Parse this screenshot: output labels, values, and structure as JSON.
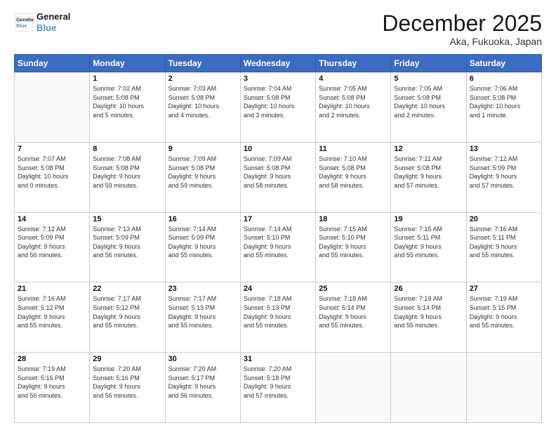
{
  "header": {
    "logo_line1": "General",
    "logo_line2": "Blue",
    "month": "December 2025",
    "location": "Aka, Fukuoka, Japan"
  },
  "weekdays": [
    "Sunday",
    "Monday",
    "Tuesday",
    "Wednesday",
    "Thursday",
    "Friday",
    "Saturday"
  ],
  "weeks": [
    [
      {
        "day": "",
        "info": ""
      },
      {
        "day": "1",
        "info": "Sunrise: 7:02 AM\nSunset: 5:08 PM\nDaylight: 10 hours\nand 5 minutes."
      },
      {
        "day": "2",
        "info": "Sunrise: 7:03 AM\nSunset: 5:08 PM\nDaylight: 10 hours\nand 4 minutes."
      },
      {
        "day": "3",
        "info": "Sunrise: 7:04 AM\nSunset: 5:08 PM\nDaylight: 10 hours\nand 3 minutes."
      },
      {
        "day": "4",
        "info": "Sunrise: 7:05 AM\nSunset: 5:08 PM\nDaylight: 10 hours\nand 2 minutes."
      },
      {
        "day": "5",
        "info": "Sunrise: 7:05 AM\nSunset: 5:08 PM\nDaylight: 10 hours\nand 2 minutes."
      },
      {
        "day": "6",
        "info": "Sunrise: 7:06 AM\nSunset: 5:08 PM\nDaylight: 10 hours\nand 1 minute."
      }
    ],
    [
      {
        "day": "7",
        "info": "Sunrise: 7:07 AM\nSunset: 5:08 PM\nDaylight: 10 hours\nand 0 minutes."
      },
      {
        "day": "8",
        "info": "Sunrise: 7:08 AM\nSunset: 5:08 PM\nDaylight: 9 hours\nand 59 minutes."
      },
      {
        "day": "9",
        "info": "Sunrise: 7:09 AM\nSunset: 5:08 PM\nDaylight: 9 hours\nand 59 minutes."
      },
      {
        "day": "10",
        "info": "Sunrise: 7:09 AM\nSunset: 5:08 PM\nDaylight: 9 hours\nand 58 minutes."
      },
      {
        "day": "11",
        "info": "Sunrise: 7:10 AM\nSunset: 5:08 PM\nDaylight: 9 hours\nand 58 minutes."
      },
      {
        "day": "12",
        "info": "Sunrise: 7:11 AM\nSunset: 5:08 PM\nDaylight: 9 hours\nand 57 minutes."
      },
      {
        "day": "13",
        "info": "Sunrise: 7:12 AM\nSunset: 5:09 PM\nDaylight: 9 hours\nand 57 minutes."
      }
    ],
    [
      {
        "day": "14",
        "info": "Sunrise: 7:12 AM\nSunset: 5:09 PM\nDaylight: 9 hours\nand 56 minutes."
      },
      {
        "day": "15",
        "info": "Sunrise: 7:13 AM\nSunset: 5:09 PM\nDaylight: 9 hours\nand 56 minutes."
      },
      {
        "day": "16",
        "info": "Sunrise: 7:14 AM\nSunset: 5:09 PM\nDaylight: 9 hours\nand 55 minutes."
      },
      {
        "day": "17",
        "info": "Sunrise: 7:14 AM\nSunset: 5:10 PM\nDaylight: 9 hours\nand 55 minutes."
      },
      {
        "day": "18",
        "info": "Sunrise: 7:15 AM\nSunset: 5:10 PM\nDaylight: 9 hours\nand 55 minutes."
      },
      {
        "day": "19",
        "info": "Sunrise: 7:15 AM\nSunset: 5:11 PM\nDaylight: 9 hours\nand 55 minutes."
      },
      {
        "day": "20",
        "info": "Sunrise: 7:16 AM\nSunset: 5:11 PM\nDaylight: 9 hours\nand 55 minutes."
      }
    ],
    [
      {
        "day": "21",
        "info": "Sunrise: 7:16 AM\nSunset: 5:12 PM\nDaylight: 9 hours\nand 55 minutes."
      },
      {
        "day": "22",
        "info": "Sunrise: 7:17 AM\nSunset: 5:12 PM\nDaylight: 9 hours\nand 55 minutes."
      },
      {
        "day": "23",
        "info": "Sunrise: 7:17 AM\nSunset: 5:13 PM\nDaylight: 9 hours\nand 55 minutes."
      },
      {
        "day": "24",
        "info": "Sunrise: 7:18 AM\nSunset: 5:13 PM\nDaylight: 9 hours\nand 55 minutes."
      },
      {
        "day": "25",
        "info": "Sunrise: 7:18 AM\nSunset: 5:14 PM\nDaylight: 9 hours\nand 55 minutes."
      },
      {
        "day": "26",
        "info": "Sunrise: 7:19 AM\nSunset: 5:14 PM\nDaylight: 9 hours\nand 55 minutes."
      },
      {
        "day": "27",
        "info": "Sunrise: 7:19 AM\nSunset: 5:15 PM\nDaylight: 9 hours\nand 55 minutes."
      }
    ],
    [
      {
        "day": "28",
        "info": "Sunrise: 7:19 AM\nSunset: 5:16 PM\nDaylight: 9 hours\nand 56 minutes."
      },
      {
        "day": "29",
        "info": "Sunrise: 7:20 AM\nSunset: 5:16 PM\nDaylight: 9 hours\nand 56 minutes."
      },
      {
        "day": "30",
        "info": "Sunrise: 7:20 AM\nSunset: 5:17 PM\nDaylight: 9 hours\nand 56 minutes."
      },
      {
        "day": "31",
        "info": "Sunrise: 7:20 AM\nSunset: 5:18 PM\nDaylight: 9 hours\nand 57 minutes."
      },
      {
        "day": "",
        "info": ""
      },
      {
        "day": "",
        "info": ""
      },
      {
        "day": "",
        "info": ""
      }
    ]
  ]
}
